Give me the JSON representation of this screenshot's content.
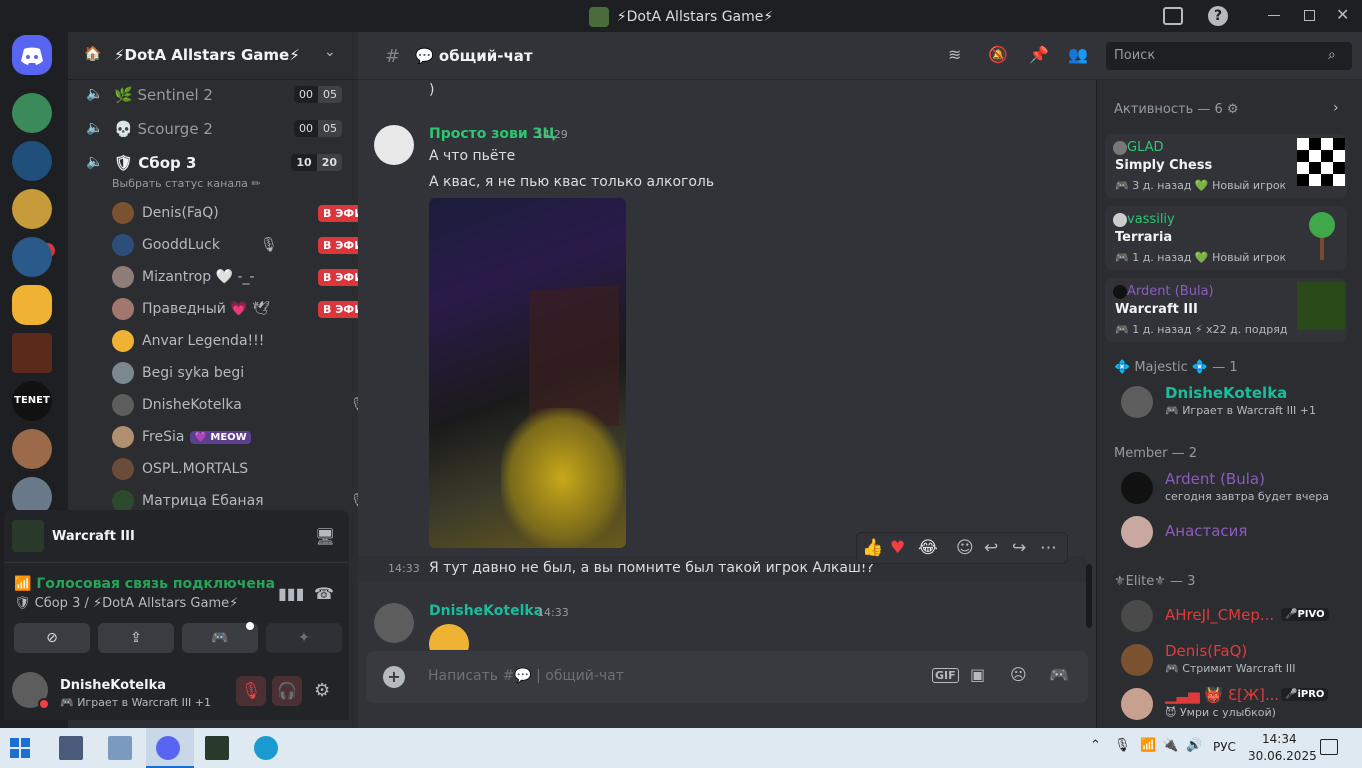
{
  "window": {
    "title": "⚡DotA Allstars Game⚡"
  },
  "guilds": {
    "badge": "650"
  },
  "server": {
    "name": "⚡DotA Allstars Game⚡"
  },
  "channels": [
    {
      "name": "🌿 Sentinel 2",
      "count": "00",
      "limit": "05"
    },
    {
      "name": "💀 Scourge 2",
      "count": "00",
      "limit": "05"
    },
    {
      "name": "🛡 Сбор 3",
      "count": "10",
      "limit": "20",
      "status": "Выбрать статус канала ✏"
    }
  ],
  "voice_users": [
    {
      "name": "Denis(FaQ)",
      "live": "В ЭФИРЕ",
      "color": "#7a5230"
    },
    {
      "name": "GooddLuck",
      "live": "В ЭФИРЕ",
      "color": "#2d4e7a"
    },
    {
      "name": "Mizantrop 🤍 -_-",
      "live": "В ЭФИРЕ",
      "color": "#8f7d77"
    },
    {
      "name": "Праведный 💗 🕊",
      "live": "В ЭФИРЕ",
      "color": "#a2776e"
    },
    {
      "name": "Anvar Legenda!!!",
      "live": "",
      "color": "#f0b232"
    },
    {
      "name": "Begi syka begi",
      "live": "",
      "color": "#7c8790"
    },
    {
      "name": "DnisheKotelka",
      "live": "",
      "color": "#5d5d5d"
    },
    {
      "name": "FreSia",
      "tag": "💜 MEOW",
      "live": "",
      "color": "#b09070"
    },
    {
      "name": "OSPL.MORTALS",
      "live": "",
      "color": "#6b4b3a"
    },
    {
      "name": "Матрица Ебаная",
      "live": "",
      "color": "#2e4a2e"
    }
  ],
  "activity_panel": {
    "game": "Warcraft III",
    "status": "Голосовая связь подключена",
    "location": "🛡 Сбор 3 / ⚡DotA Allstars Game⚡"
  },
  "user_panel": {
    "name": "DnisheKotelka",
    "status": "🎮 Играет в Warcraft III +1"
  },
  "channel": {
    "name": "общий-чат",
    "search_placeholder": "Поиск"
  },
  "messages": {
    "top_fragment": ")",
    "first": {
      "author": "Просто зови ЗЦ",
      "time": "14:29",
      "lines": [
        "А что пьёте",
        "А квас, я не пью квас только алкоголь"
      ]
    },
    "hover": {
      "time": "14:33",
      "text": "Я тут давно не был, а вы помните был такой игрок Алкаш!?"
    },
    "second": {
      "author": "DnisheKotelka",
      "time": "14:33"
    }
  },
  "composer": {
    "placeholder": "Написать #💬 | общий-чат"
  },
  "members": {
    "activity_title": "Активность — 6 ⚙",
    "activities": [
      {
        "user": "GLAD",
        "user_color": "#2dc770",
        "game": "Simply Chess",
        "meta": "🎮 3 д. назад  💚 Новый игрок"
      },
      {
        "user": "vassiliy",
        "user_color": "#2dc770",
        "game": "Terraria",
        "meta": "🎮 1 д. назад  💚 Новый игрок"
      },
      {
        "user": "Ardent (Bula)",
        "user_color": "#8c5bbf",
        "game": "Warcraft III",
        "meta": "🎮 1 д. назад  ⚡ x22 д. подряд"
      }
    ],
    "sections": [
      {
        "title": "💠 Majestic 💠 — 1",
        "members": [
          {
            "name": "DnisheKotelka",
            "color": "#1abc9c",
            "status": "🎮 Играет в Warcraft III +1"
          }
        ]
      },
      {
        "title": "Member — 2",
        "members": [
          {
            "name": "Ardent (Bula)",
            "color": "#8c5bbf",
            "status": "сегодня завтра будет вчера"
          },
          {
            "name": "Анастасия",
            "color": "#8c5bbf",
            "status": ""
          }
        ]
      },
      {
        "title": "⚜Elite⚜ — 3",
        "members": [
          {
            "name": "AHreJl_CMep...",
            "color": "#e03b3b",
            "status": "",
            "tag": "🎤PIVO"
          },
          {
            "name": "Denis(FaQ)",
            "color": "#e03b3b",
            "status": "🎮 Стримит Warcraft III"
          },
          {
            "name": "▁▃▅ 👹 Ɛ[Ж]...",
            "color": "#e03b3b",
            "status": "😈 Умри с улыбкой)",
            "tag": "🎤iPRO"
          }
        ]
      }
    ]
  },
  "taskbar": {
    "time": "14:34",
    "date": "30.06.2025",
    "lang": "РУС"
  }
}
